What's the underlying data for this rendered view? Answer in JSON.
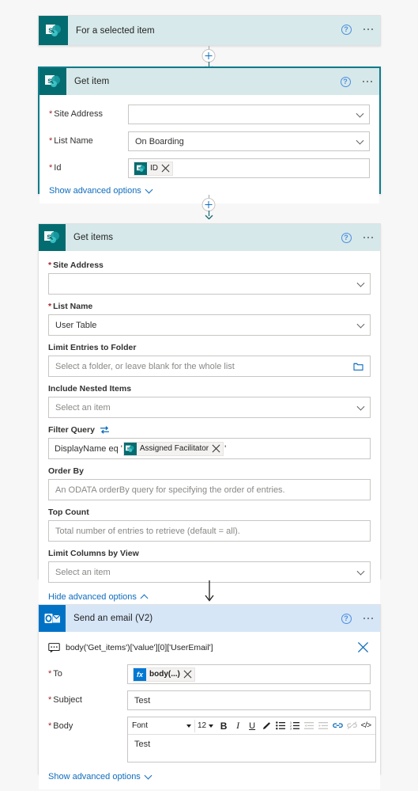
{
  "flow": {
    "colors": {
      "sharepoint": "#036c70",
      "outlook": "#0072c6",
      "selected_border": "#0f7b8a",
      "link": "#0f6cbd",
      "required": "#a4262c",
      "header_sharepoint": "#d7e9ea",
      "header_outlook": "#d6e6f7"
    },
    "steps": [
      {
        "id": "for-a-selected-item",
        "title": "For a selected item",
        "connector_icon": "sharepoint-icon",
        "help_icon": "help-icon",
        "more_icon": "more-options-icon",
        "collapsed": true
      },
      {
        "id": "get-item",
        "title": "Get item",
        "connector_icon": "sharepoint-icon",
        "help_icon": "help-icon",
        "more_icon": "more-options-icon",
        "selected": true,
        "fields": [
          {
            "label": "Site Address",
            "required": true,
            "value": "",
            "placeholder": "",
            "control": "dropdown"
          },
          {
            "label": "List Name",
            "required": true,
            "value": "On Boarding",
            "placeholder": "",
            "control": "dropdown"
          },
          {
            "label": "Id",
            "required": true,
            "control": "token",
            "token": {
              "icon": "sharepoint-icon",
              "text": "ID"
            }
          }
        ],
        "advanced_link": "Show advanced options",
        "advanced_state": "collapsed"
      },
      {
        "id": "get-items",
        "title": "Get items",
        "connector_icon": "sharepoint-icon",
        "help_icon": "help-icon",
        "more_icon": "more-options-icon",
        "fields": [
          {
            "label": "Site Address",
            "required": true,
            "value": "",
            "placeholder": "",
            "control": "dropdown"
          },
          {
            "label": "List Name",
            "required": true,
            "value": "User Table",
            "placeholder": "",
            "control": "dropdown"
          },
          {
            "label": "Limit Entries to Folder",
            "required": false,
            "value": "",
            "placeholder": "Select a folder, or leave blank for the whole list",
            "control": "folder-picker"
          },
          {
            "label": "Include Nested Items",
            "required": false,
            "value": "",
            "placeholder": "Select an item",
            "control": "dropdown"
          },
          {
            "label": "Filter Query",
            "required": false,
            "control": "token-expression",
            "toggle_icon": "swap-input-icon",
            "expression": {
              "prefix": "DisplayName eq '",
              "token": {
                "icon": "sharepoint-icon",
                "text": "Assigned Facilitator"
              },
              "suffix": "'"
            }
          },
          {
            "label": "Order By",
            "required": false,
            "value": "",
            "placeholder": "An ODATA orderBy query for specifying the order of entries.",
            "control": "text"
          },
          {
            "label": "Top Count",
            "required": false,
            "value": "",
            "placeholder": "Total number of entries to retrieve (default = all).",
            "control": "text"
          },
          {
            "label": "Limit Columns by View",
            "required": false,
            "value": "",
            "placeholder": "Select an item",
            "control": "dropdown"
          }
        ],
        "advanced_link": "Hide advanced options",
        "advanced_state": "expanded"
      },
      {
        "id": "send-an-email-v2",
        "title": "Send an email (V2)",
        "connector_icon": "outlook-icon",
        "help_icon": "help-icon",
        "more_icon": "more-options-icon",
        "expression_bar": {
          "icon": "comment-icon",
          "text": "body('Get_items')['value'][0]['UserEmail']",
          "close_icon": "close-icon"
        },
        "fields": [
          {
            "label": "To",
            "required": true,
            "control": "token",
            "token": {
              "icon": "fx-icon",
              "text": "body(...)"
            }
          },
          {
            "label": "Subject",
            "required": true,
            "value": "Test",
            "placeholder": "",
            "control": "text"
          },
          {
            "label": "Body",
            "required": true,
            "control": "rich-text",
            "value": "Test"
          }
        ],
        "advanced_link": "Show advanced options",
        "advanced_state": "collapsed"
      }
    ],
    "rich_text_toolbar": {
      "font_label": "Font",
      "size_label": "12",
      "buttons": [
        {
          "name": "bold-icon",
          "glyph": "B"
        },
        {
          "name": "italic-icon",
          "glyph": "I"
        },
        {
          "name": "underline-icon",
          "glyph": "U"
        },
        {
          "name": "text-highlight-icon",
          "glyph": "pen"
        },
        {
          "name": "bulleted-list-icon",
          "glyph": "bullets"
        },
        {
          "name": "numbered-list-icon",
          "glyph": "numbers"
        },
        {
          "name": "decrease-indent-icon",
          "glyph": "outdent"
        },
        {
          "name": "increase-indent-icon",
          "glyph": "indent"
        },
        {
          "name": "insert-link-icon",
          "glyph": "link"
        },
        {
          "name": "remove-link-icon",
          "glyph": "unlink"
        },
        {
          "name": "code-view-icon",
          "glyph": "</>"
        }
      ]
    },
    "connectors": [
      {
        "type": "plus-arrow",
        "name": "add-step-between-trigger-and-get-item"
      },
      {
        "type": "plus-arrow",
        "name": "add-step-between-get-item-and-get-items"
      },
      {
        "type": "arrow",
        "name": "connector-get-items-to-send-email"
      }
    ]
  }
}
